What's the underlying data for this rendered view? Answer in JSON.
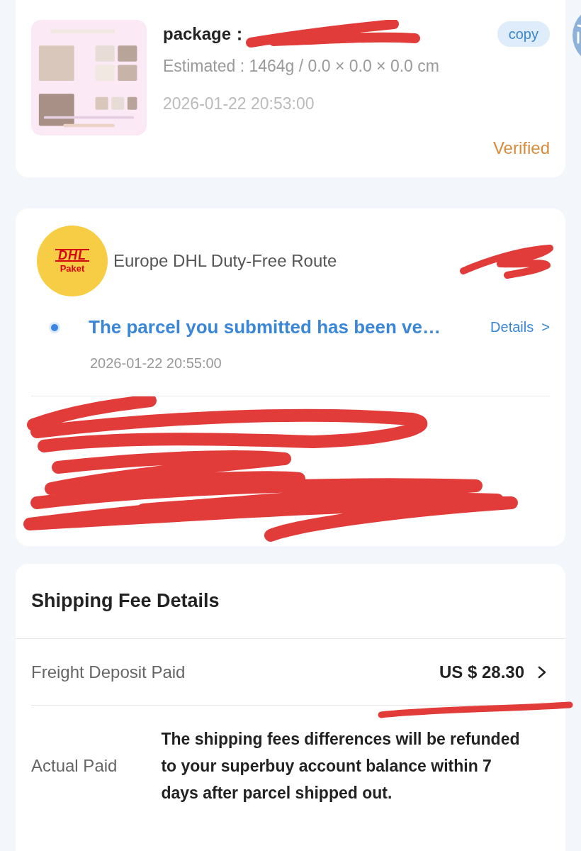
{
  "package": {
    "title": "package：",
    "copy_label": "copy",
    "estimate": "Estimated : 1464g / 0.0 × 0.0 × 0.0 cm",
    "time": "2026-01-22 20:53:00",
    "status": "Verified"
  },
  "route": {
    "logo_text": "DHL",
    "logo_subtext": "Paket",
    "name": "Europe DHL Duty-Free Route",
    "tracking": {
      "message": "The parcel you submitted has been ve…",
      "details_label": "Details",
      "details_arrow": ">",
      "time": "2026-01-22 20:55:00"
    }
  },
  "fee": {
    "title": "Shipping Fee Details",
    "rows": [
      {
        "kind": "amount",
        "label": "Freight Deposit Paid",
        "value": "US $ 28.30"
      },
      {
        "kind": "note",
        "label": "Actual Paid",
        "value": "The shipping fees differences will be refunded to your superbuy account balance within 7 days after parcel shipped out."
      }
    ]
  }
}
